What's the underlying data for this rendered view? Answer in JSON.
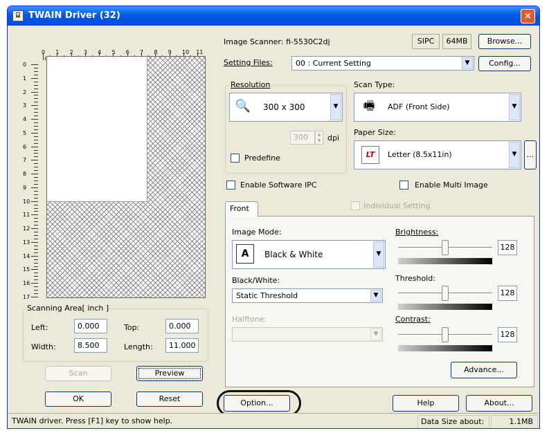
{
  "window": {
    "title": "TWAIN Driver (32)",
    "close_glyph": "×"
  },
  "ruler": {
    "h_ticks": [
      "0",
      "1",
      "2",
      "3",
      "4",
      "5",
      "6",
      "7",
      "8",
      "9",
      "10",
      "11"
    ],
    "v_ticks": [
      "0",
      "1",
      "2",
      "3",
      "4",
      "5",
      "6",
      "7",
      "8",
      "9",
      "10",
      "11",
      "12",
      "13",
      "14",
      "15",
      "16",
      "17"
    ]
  },
  "scanning_area": {
    "title": "Scanning Area[ inch ]",
    "left_label": "Left:",
    "left_value": "0.000",
    "top_label": "Top:",
    "top_value": "0.000",
    "width_label": "Width:",
    "width_value": "8.500",
    "length_label": "Length:",
    "length_value": "11.000"
  },
  "left_buttons": {
    "scan": "Scan",
    "preview": "Preview",
    "ok": "OK",
    "reset": "Reset"
  },
  "scanner": {
    "label": "Image Scanner: fi-5530C2dj",
    "sipc": "SIPC",
    "mem": "64MB",
    "browse": "Browse..."
  },
  "setting_files": {
    "label": "Setting Files:",
    "value": "00 : Current Setting",
    "config": "Config..."
  },
  "resolution": {
    "group": "Resolution",
    "value": "300 x 300",
    "spin": "300",
    "unit": "dpi",
    "predefine": "Predefine"
  },
  "scan_type": {
    "label": "Scan Type:",
    "value": "ADF (Front Side)"
  },
  "paper_size": {
    "label": "Paper Size:",
    "value": "Letter (8.5x11in)",
    "icon_text": "LT",
    "more": "..."
  },
  "options": {
    "software_ipc": "Enable Software IPC",
    "multi_image": "Enable Multi Image",
    "individual": "Individual Setting"
  },
  "tabs": {
    "front": "Front"
  },
  "image_mode": {
    "label": "Image Mode:",
    "value": "Black & White"
  },
  "bw": {
    "label": "Black/White:",
    "value": "Static Threshold"
  },
  "halftone": {
    "label": "Halftone:",
    "value": ""
  },
  "brightness": {
    "label": "Brightness:",
    "value": "128",
    "level": 0.5
  },
  "threshold": {
    "label": "Threshold:",
    "value": "128",
    "level": 0.5
  },
  "contrast": {
    "label": "Contrast:",
    "value": "128",
    "level": 0.5
  },
  "advance": "Advance...",
  "bottom_buttons": {
    "option": "Option...",
    "help": "Help",
    "about": "About..."
  },
  "status": {
    "help": "TWAIN driver. Press [F1] key to show help.",
    "data_size_label": "Data Size about:",
    "data_size_value": "1.1MB"
  },
  "dropdown_glyph": "▼"
}
